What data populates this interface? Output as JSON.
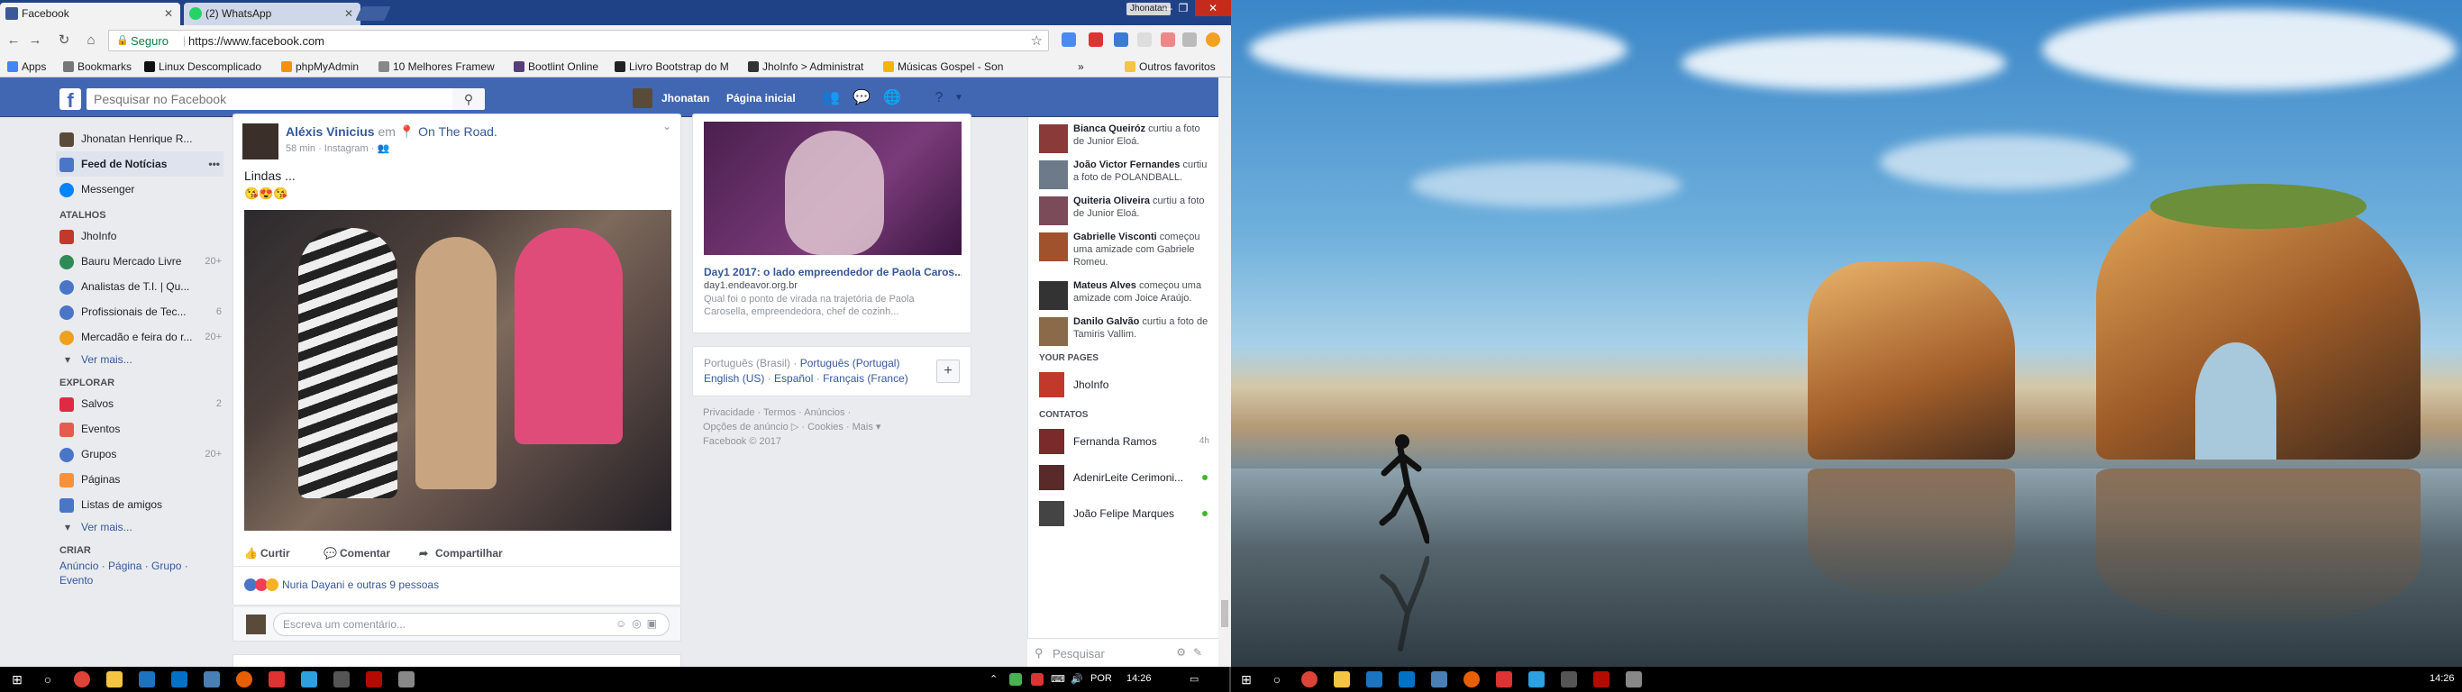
{
  "browser": {
    "tabs": [
      {
        "label": "Facebook",
        "favicon_color": "#3b5998",
        "active": true
      },
      {
        "label": "(2) WhatsApp",
        "favicon_color": "#25d366",
        "active": false
      }
    ],
    "profile_name": "Jhonatan",
    "address_security": "Seguro",
    "url": "https://www.facebook.com"
  },
  "bookmarks": [
    {
      "label": "Apps",
      "color": "#4285f4"
    },
    {
      "label": "Bookmarks",
      "color": "#777777"
    },
    {
      "label": "Linux Descomplicado",
      "color": "#111111"
    },
    {
      "label": "phpMyAdmin",
      "color": "#f29111"
    },
    {
      "label": "10 Melhores Framew",
      "color": "#888888"
    },
    {
      "label": "Bootlint Online",
      "color": "#563d7c"
    },
    {
      "label": "Livro Bootstrap do M",
      "color": "#222222"
    },
    {
      "label": "JhoInfo > Administrat",
      "color": "#333333"
    },
    {
      "label": "Músicas Gospel - Son",
      "color": "#f4b400"
    }
  ],
  "bookmarks_overflow": "»",
  "bookmarks_other": "Outros favoritos",
  "facebook": {
    "search_placeholder": "Pesquisar no Facebook",
    "user_first_name": "Jhonatan",
    "home_label": "Página inicial"
  },
  "left_nav": {
    "profile": "Jhonatan Henrique R...",
    "news_feed": "Feed de Notícias",
    "messenger": "Messenger",
    "shortcuts_header": "ATALHOS",
    "shortcuts": [
      {
        "label": "JhoInfo",
        "count": "",
        "color": "#c0392b"
      },
      {
        "label": "Bauru Mercado Livre",
        "count": "20+",
        "color": "#2e8b57"
      },
      {
        "label": "Analistas de T.I. | Qu...",
        "count": "",
        "color": "#4a76c8"
      },
      {
        "label": "Profissionais de Tec...",
        "count": "6",
        "color": "#4a76c8"
      },
      {
        "label": "Mercadão e feira do r...",
        "count": "20+",
        "color": "#f0a020"
      }
    ],
    "see_more_1": "Ver mais...",
    "explore_header": "EXPLORAR",
    "explore": [
      {
        "label": "Salvos",
        "count": "2",
        "color": "#e02a45"
      },
      {
        "label": "Eventos",
        "count": "",
        "color": "#e55c4f"
      },
      {
        "label": "Grupos",
        "count": "20+",
        "color": "#4a76c8"
      },
      {
        "label": "Páginas",
        "count": "",
        "color": "#f7923a"
      },
      {
        "label": "Listas de amigos",
        "count": "",
        "color": "#4a76c8"
      }
    ],
    "see_more_2": "Ver mais...",
    "create_header": "CRIAR",
    "create_links": "Anúncio · Página · Grupo · Evento"
  },
  "post": {
    "author": "Aléxis Vinicius",
    "location_prefix": "em",
    "location": "On The Road.",
    "meta": "58 min · Instagram ·",
    "text": "Lindas ...",
    "emoji": "😘😍😘",
    "like": "Curtir",
    "comment": "Comentar",
    "share": "Compartilhar",
    "reactions": "Nuria Dayani e outras 9 pessoas",
    "comment_placeholder": "Escreva um comentário..."
  },
  "ad": {
    "title": "Day1 2017: o lado empreendedor de Paola Caros...",
    "url": "day1.endeavor.org.br",
    "desc": "Qual foi o ponto de virada na trajetória de Paola Carosella, empreendedora, chef de cozinh..."
  },
  "languages": {
    "current": "Português (Brasil)",
    "others": [
      "Português (Portugal)",
      "English (US)",
      "Español",
      "Français (France)"
    ]
  },
  "footer": {
    "line1": "Privacidade · Termos · Anúncios ·",
    "line2": "Opções de anúncio ▷ · Cookies · Mais ▾",
    "line3": "Facebook © 2017"
  },
  "ticker": [
    {
      "name": "Bianca Queiróz",
      "text": "curtiu a foto de Junior Eloá.",
      "color": "#8b3a3a"
    },
    {
      "name": "João Victor Fernandes",
      "text": "curtiu a foto de POLANDBALL.",
      "color": "#6c7a89"
    },
    {
      "name": "Quiteria Oliveira",
      "text": "curtiu a foto de Junior Eloá.",
      "color": "#7b4b5a"
    },
    {
      "name": "Gabrielle Visconti",
      "text": "começou uma amizade com Gabriele Romeu.",
      "color": "#a0522d"
    },
    {
      "name": "Mateus Alves",
      "text": "começou uma amizade com Joice Araújo.",
      "color": "#333333"
    },
    {
      "name": "Danilo Galvão",
      "text": "curtiu a foto de Tamiris Vallim.",
      "color": "#8b6a4a"
    }
  ],
  "your_pages_header": "YOUR PAGES",
  "your_page": "JhoInfo",
  "contacts_header": "CONTATOS",
  "contacts": [
    {
      "name": "Fernanda Ramos",
      "time": "4h",
      "online": false,
      "color": "#7a2a2a"
    },
    {
      "name": "AdenirLeite Cerimoni...",
      "time": "",
      "online": true,
      "color": "#5a2a2a"
    },
    {
      "name": "João Felipe Marques",
      "time": "",
      "online": true,
      "color": "#444444"
    }
  ],
  "chat_search_placeholder": "Pesquisar",
  "taskbar": {
    "language": "POR",
    "time_left": "14:26",
    "time_right": "14:26"
  }
}
